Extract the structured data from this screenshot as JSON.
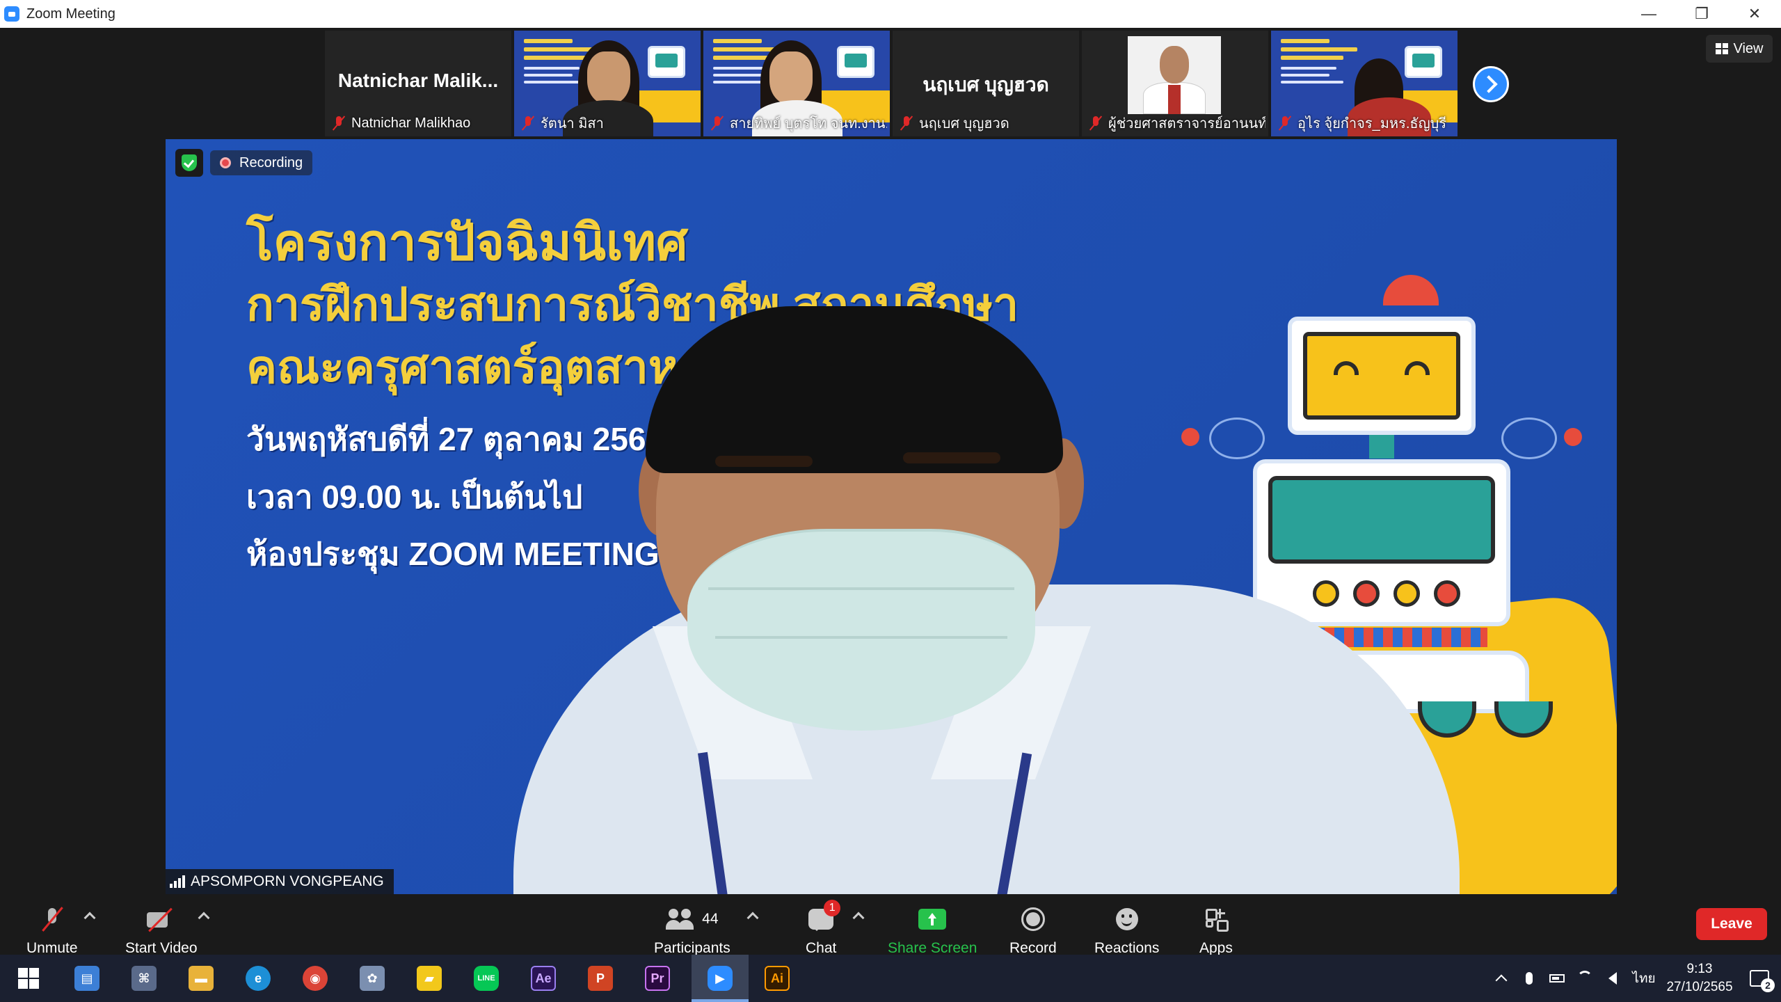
{
  "window": {
    "title": "Zoom Meeting",
    "minimize": "—",
    "restore": "❐",
    "close": "✕"
  },
  "view_button": {
    "label": "View"
  },
  "thumbnails": [
    {
      "big_name": "Natnichar  Malik...",
      "label": "Natnichar Malikhao",
      "kind": "name"
    },
    {
      "label": "รัตนา  มิสา",
      "kind": "video"
    },
    {
      "label": "สายทิพย์ บุตรโท จนท.งาน...",
      "kind": "video2"
    },
    {
      "big_name": "นฤเบศ บุญฮวด",
      "label": "นฤเบศ บุญฮวด",
      "kind": "name"
    },
    {
      "label": "ผู้ช่วยศาสตราจารย์อานนท์...",
      "kind": "photo"
    },
    {
      "label": "อุไร จุ้ยกำจร_มหร.ธัญบุรี",
      "kind": "video3"
    }
  ],
  "main_video": {
    "recording_label": "Recording",
    "speaker_name": "APSOMPORN VONGPEANG",
    "slide_lines": [
      "โครงการปัจฉิมนิเทศ",
      "การฝึกประสบการณ์วิชาชีพ      สถานศึกษา",
      "คณะครุศาสตร์อุตสาหก",
      "วันพฤหัสบดีที่ 27 ตุลาคม 2565",
      "เวลา 09.00 น. เป็นต้นไป",
      "ห้องประชุม ZOOM MEETING ID : 3"
    ]
  },
  "toolbar": {
    "unmute": "Unmute",
    "start_video": "Start Video",
    "participants": "Participants",
    "participants_count": "44",
    "chat": "Chat",
    "chat_badge": "1",
    "share_screen": "Share Screen",
    "record": "Record",
    "reactions": "Reactions",
    "apps": "Apps",
    "leave": "Leave"
  },
  "taskbar": {
    "apps": [
      {
        "name": "start",
        "glyph": ""
      },
      {
        "name": "news",
        "glyph": "▤",
        "color": "#3c7fd6"
      },
      {
        "name": "files",
        "glyph": "⌘",
        "color": "#5a6a8a"
      },
      {
        "name": "explorer",
        "glyph": "▬",
        "color": "#e8b23a"
      },
      {
        "name": "edge",
        "glyph": "e",
        "color": "#1d8fd6"
      },
      {
        "name": "chrome",
        "glyph": "◉",
        "color": "#db4437"
      },
      {
        "name": "app7",
        "glyph": "✿",
        "color": "#7b8fb0"
      },
      {
        "name": "sticky-notes",
        "glyph": "▰",
        "color": "#f2c81b"
      },
      {
        "name": "line",
        "glyph": "LINE",
        "color": "#06c755"
      },
      {
        "name": "after-effects",
        "glyph": "Ae",
        "color": "#2a1455"
      },
      {
        "name": "powerpoint",
        "glyph": "P",
        "color": "#d04423"
      },
      {
        "name": "premiere",
        "glyph": "Pr",
        "color": "#2a0a3f"
      },
      {
        "name": "zoom",
        "glyph": "▶",
        "color": "#2d8cff"
      },
      {
        "name": "illustrator",
        "glyph": "Ai",
        "color": "#331c00"
      }
    ],
    "tray": {
      "language": "ไทย",
      "time": "9:13",
      "date": "27/10/2565",
      "notifications": "2"
    }
  },
  "colors": {
    "zoom_blue": "#2d8cff",
    "leave_red": "#e02828",
    "share_green": "#27c24c",
    "slide_blue": "#1f4fb3",
    "slide_yellow": "#f4cf3c"
  }
}
